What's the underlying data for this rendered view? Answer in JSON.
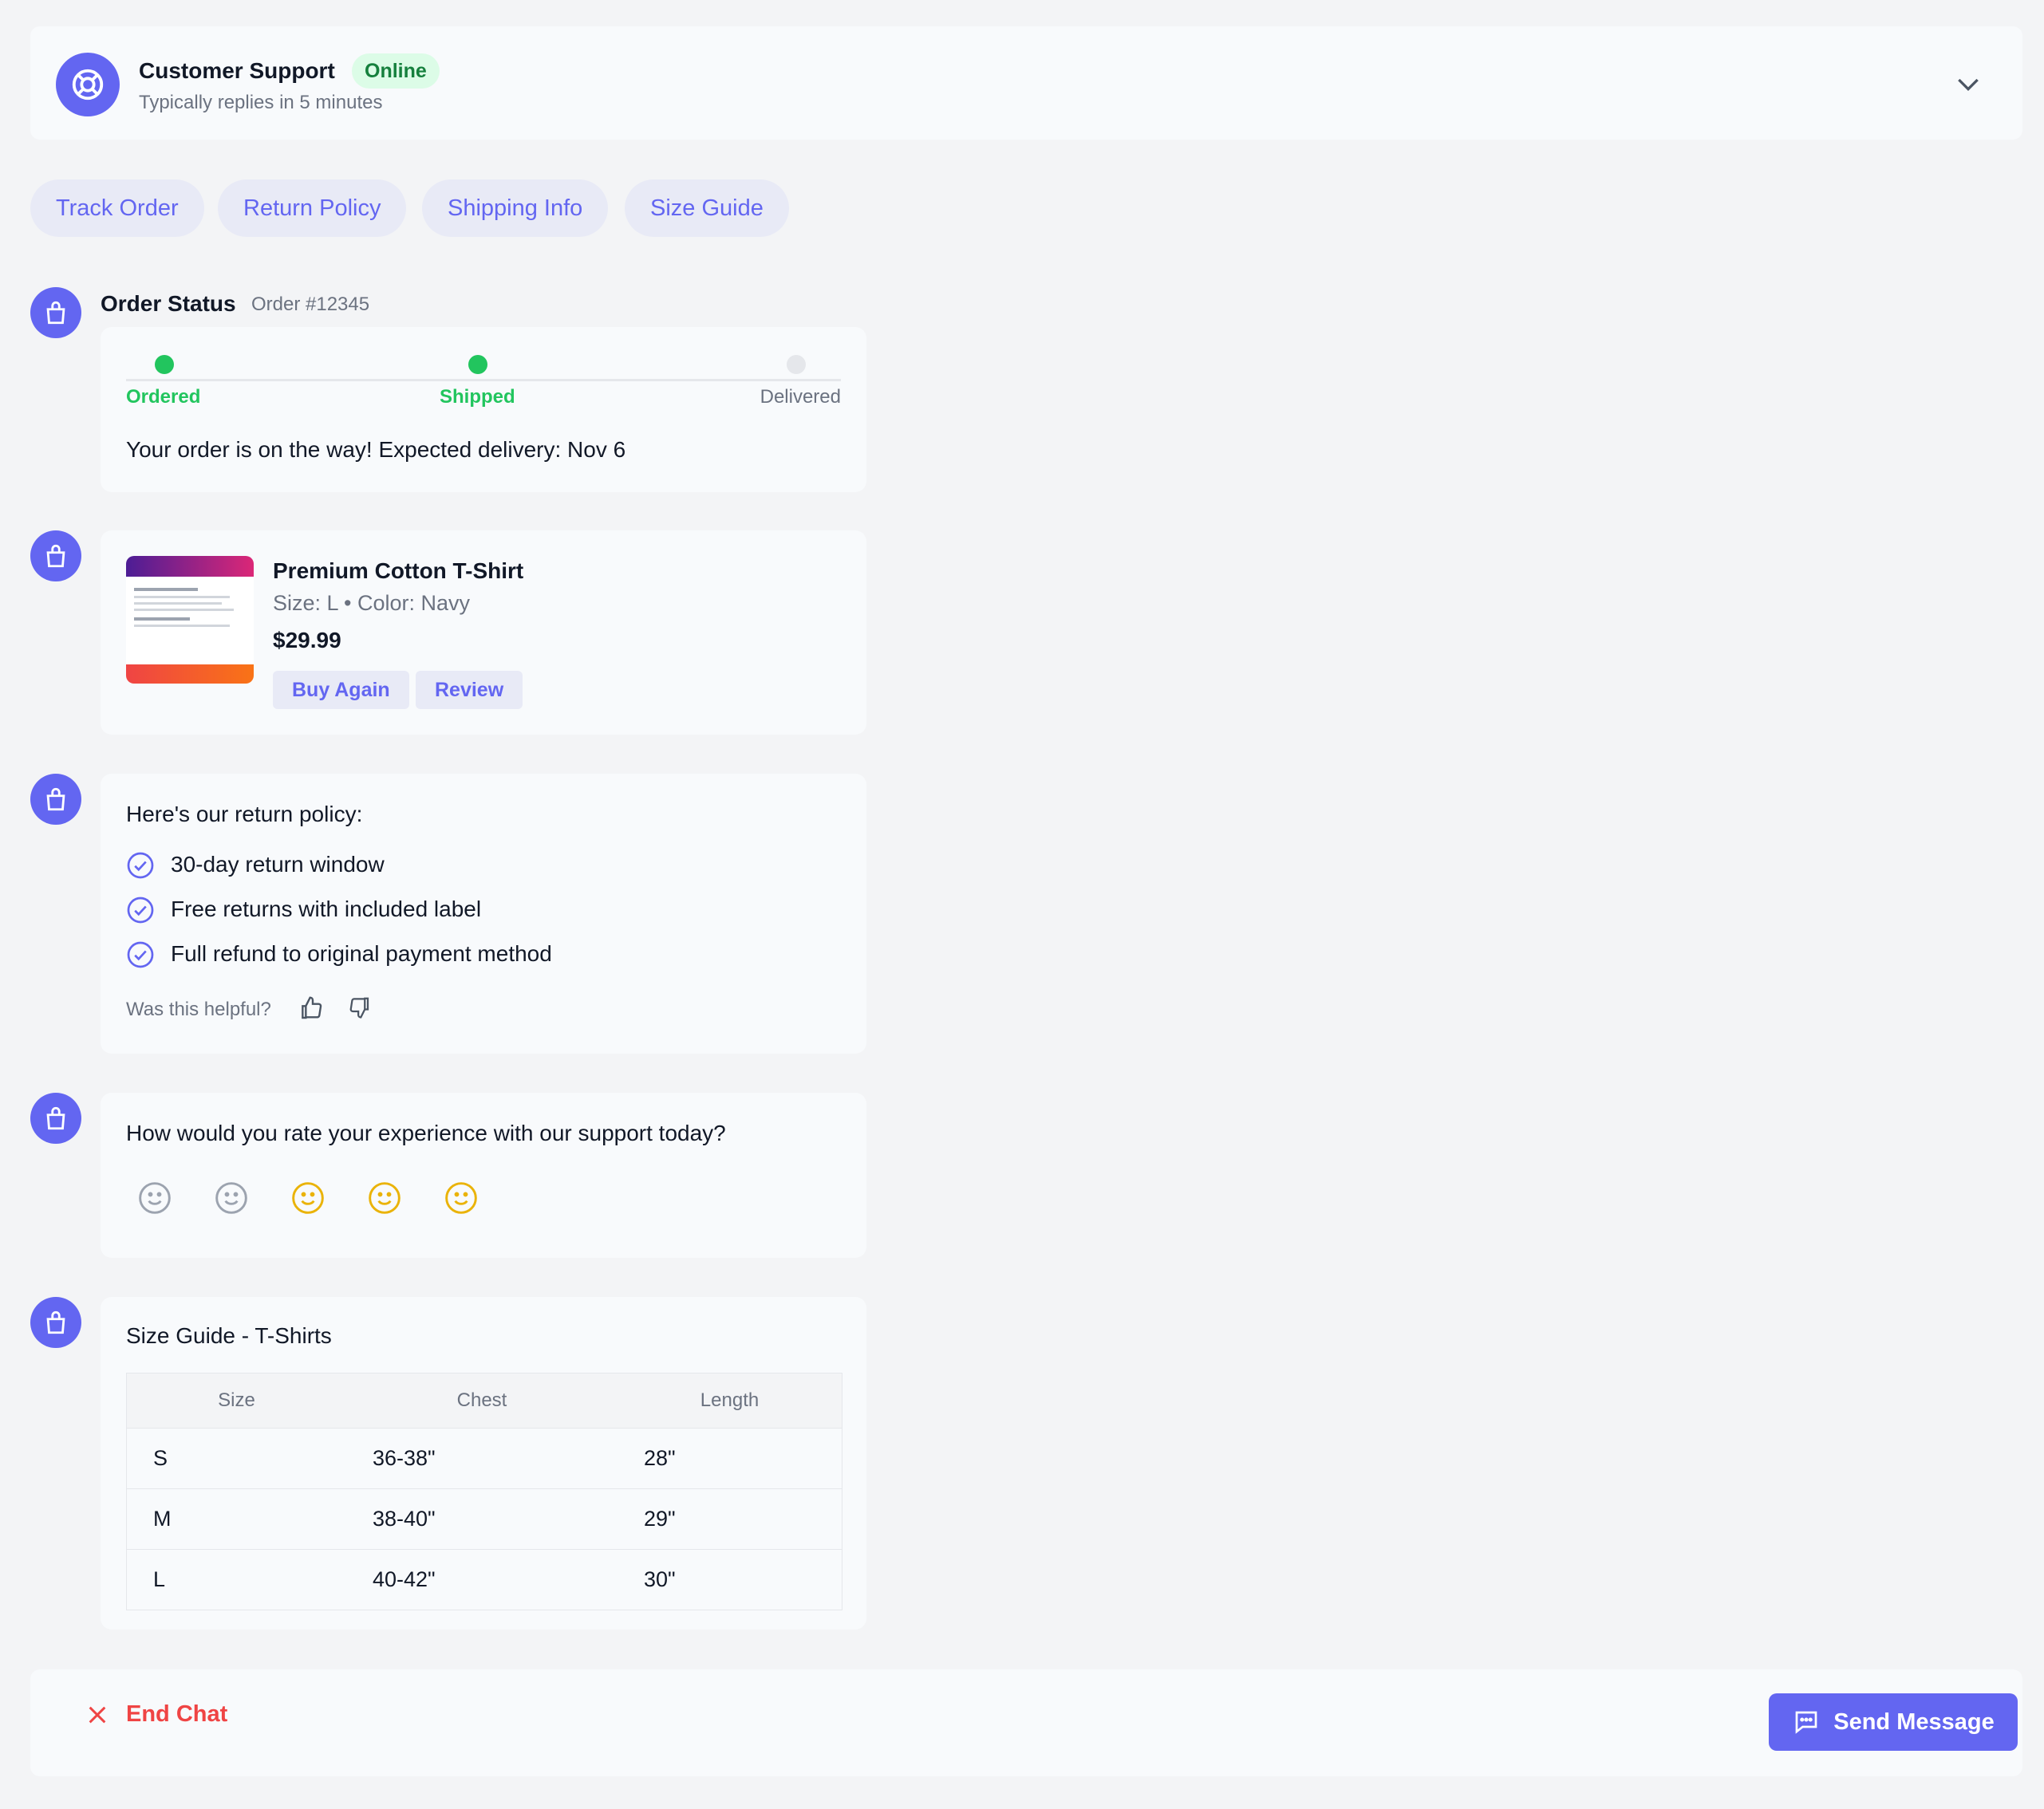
{
  "header": {
    "title": "Customer Support",
    "status": "Online",
    "subtitle": "Typically replies in 5 minutes"
  },
  "quick_replies": [
    "Track Order",
    "Return Policy",
    "Shipping Info",
    "Size Guide"
  ],
  "order_status": {
    "title": "Order Status",
    "order_number": "Order #12345",
    "steps": [
      "Ordered",
      "Shipped",
      "Delivered"
    ],
    "message": "Your order is on the way! Expected delivery: Nov 6"
  },
  "product": {
    "name": "Premium Cotton T-Shirt",
    "details": "Size: L • Color: Navy",
    "price": "$29.99",
    "buy_again": "Buy Again",
    "review": "Review"
  },
  "return_policy": {
    "intro": "Here's our return policy:",
    "items": [
      "30-day return window",
      "Free returns with included label",
      "Full refund to original payment method"
    ],
    "helpful": "Was this helpful?"
  },
  "rating": {
    "question": "How would you rate your experience with our support today?"
  },
  "size_guide": {
    "title": "Size Guide - T-Shirts",
    "headers": [
      "Size",
      "Chest",
      "Length"
    ],
    "rows": [
      [
        "S",
        "36-38\"",
        "28\""
      ],
      [
        "M",
        "38-40\"",
        "29\""
      ],
      [
        "L",
        "40-42\"",
        "30\""
      ]
    ]
  },
  "footer": {
    "end_chat": "End Chat",
    "send": "Send Message"
  },
  "colors": {
    "accent": "#6366f1",
    "success": "#22c55e",
    "danger": "#ef4444",
    "star": "#eab308"
  }
}
